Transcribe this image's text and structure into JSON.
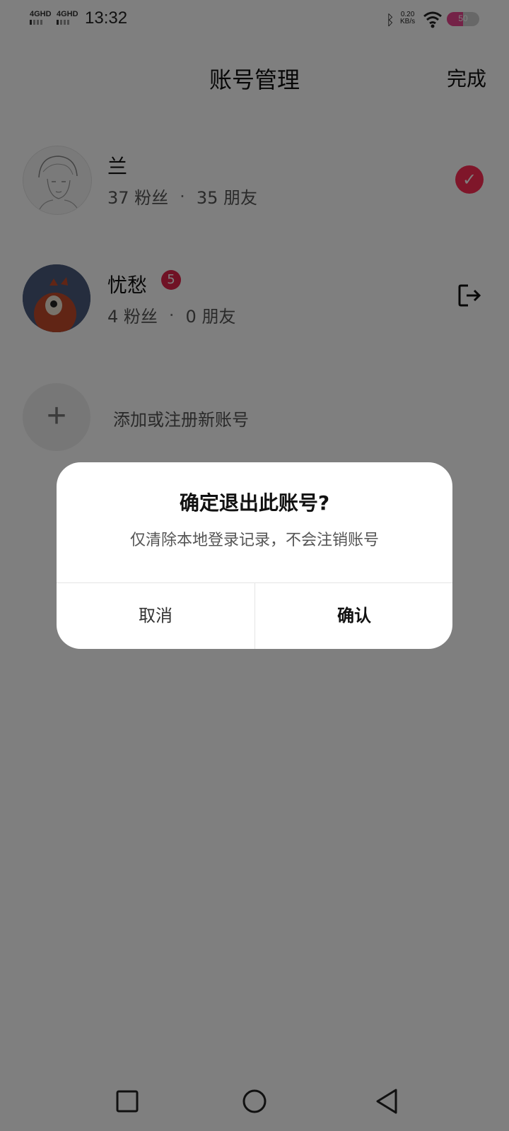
{
  "status_bar": {
    "sim1": "4GHD",
    "sim2": "4GHD",
    "time": "13:32",
    "speed_value": "0.20",
    "speed_unit": "KB/s",
    "battery": "50",
    "battery_level": 0.5,
    "battery_color": "#e9458f"
  },
  "header": {
    "title": "账号管理",
    "done_label": "完成"
  },
  "accounts": [
    {
      "name": "兰",
      "fans": "37 粉丝",
      "separator": "·",
      "friends": "35 朋友",
      "status_icon": "check-icon"
    },
    {
      "name": "忧愁",
      "badge": "5",
      "fans": "4 粉丝",
      "separator": "·",
      "friends": "0 朋友",
      "status_icon": "logout-icon"
    }
  ],
  "add_account": {
    "icon": "+",
    "label": "添加或注册新账号"
  },
  "dialog": {
    "title": "确定退出此账号?",
    "message": "仅清除本地登录记录，不会注销账号",
    "cancel_label": "取消",
    "confirm_label": "确认"
  },
  "accent_color": "#ff2d55"
}
